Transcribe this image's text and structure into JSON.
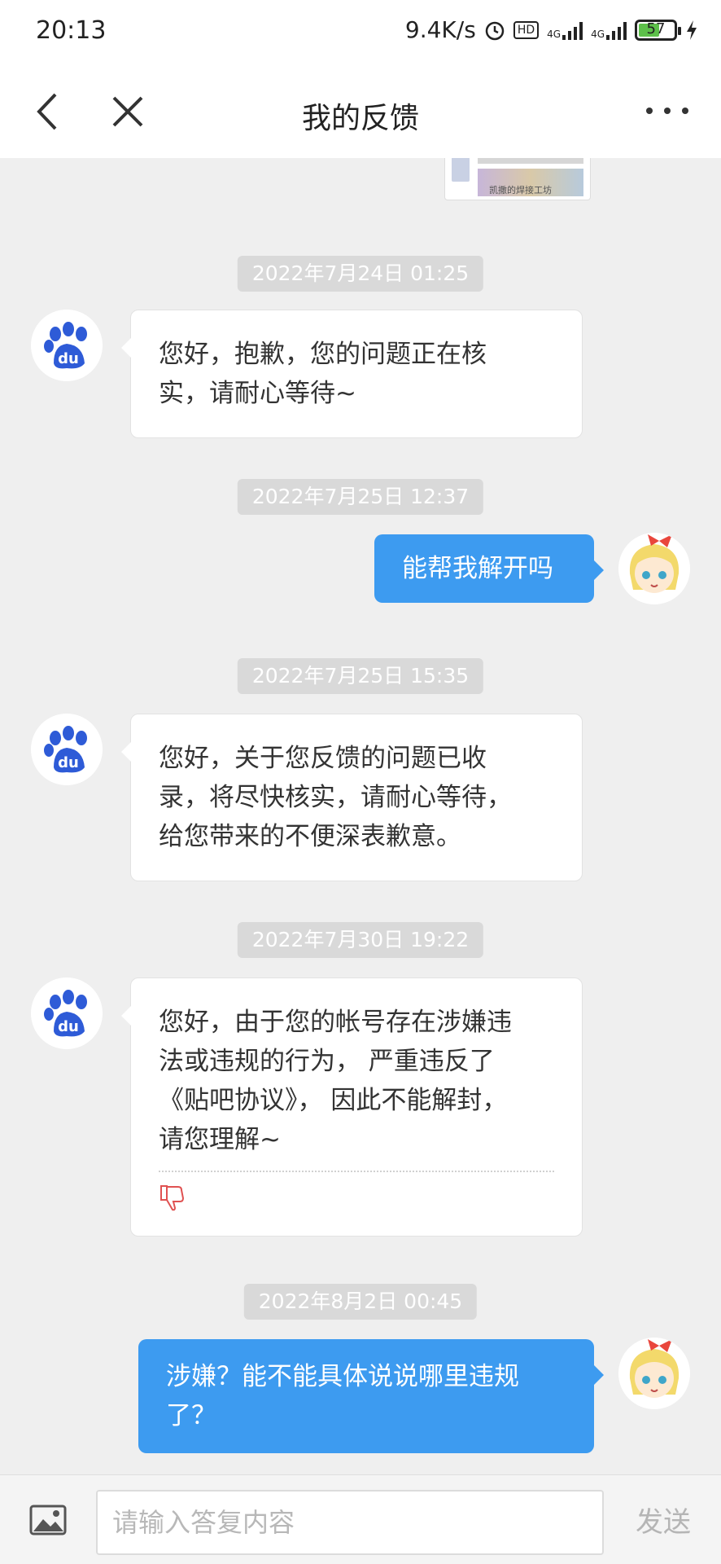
{
  "status_bar": {
    "time": "20:13",
    "speed": "9.4K/s",
    "hd": "HD",
    "net1": "4G",
    "net2": "4G",
    "battery": "57"
  },
  "header": {
    "title": "我的反馈"
  },
  "chat": {
    "thumbnail_caption": "凯撒的焊接工坊",
    "messages": [
      {
        "timestamp": "2022年7月24日 01:25",
        "sender": "baidu",
        "text_lines": [
          "您好，抱歉，您的问题正在核",
          "实，请耐心等待~"
        ]
      },
      {
        "timestamp": "2022年7月25日 12:37",
        "sender": "user",
        "text_lines": [
          "能帮我解开吗"
        ]
      },
      {
        "timestamp": "2022年7月25日 15:35",
        "sender": "baidu",
        "text_lines": [
          "您好，关于您反馈的问题已收",
          "录，将尽快核实，请耐心等待，",
          "给您带来的不便深表歉意。"
        ]
      },
      {
        "timestamp": "2022年7月30日 19:22",
        "sender": "baidu",
        "text_lines": [
          "您好，由于您的帐号存在涉嫌违",
          "法或违规的行为， 严重违反了",
          "《贴吧协议》， 因此不能解封，",
          "请您理解~"
        ]
      },
      {
        "timestamp": "2022年8月2日 00:45",
        "sender": "user",
        "text_lines": [
          "涉嫌？能不能具体说说哪里违规",
          "了？"
        ]
      }
    ]
  },
  "input_bar": {
    "placeholder": "请输入答复内容",
    "send_label": "发送"
  },
  "colors": {
    "user_bubble": "#3d9bf0",
    "baidu_blue": "#2e5bd7",
    "dislike_red": "#e05252"
  }
}
